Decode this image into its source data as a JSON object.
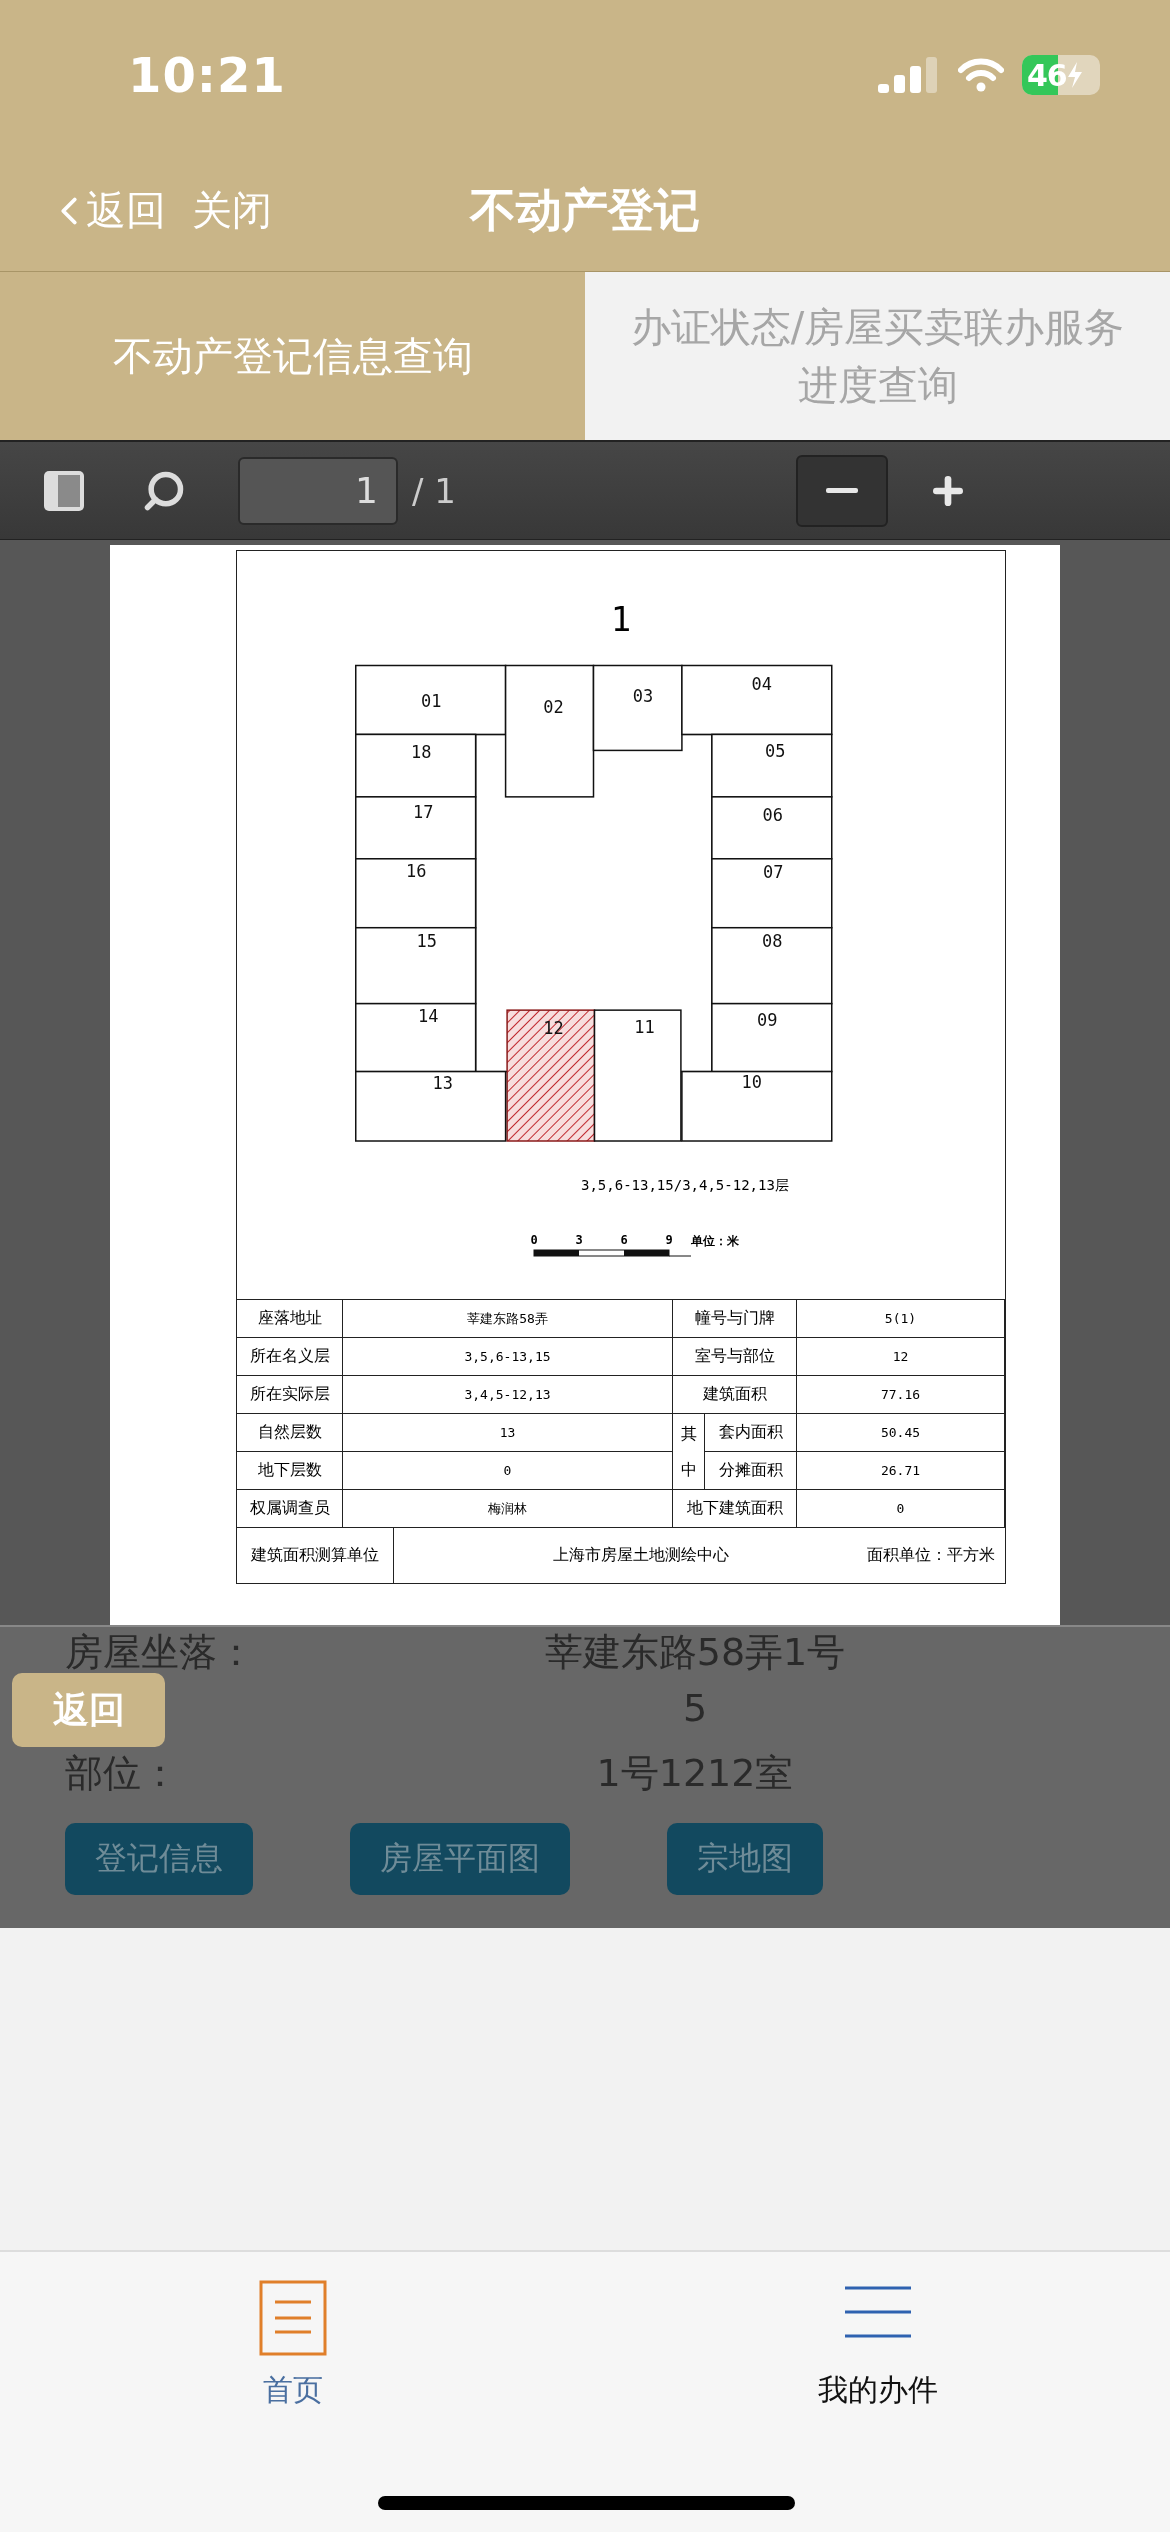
{
  "status_bar": {
    "time": "10:21",
    "battery": "46"
  },
  "nav": {
    "back": "返回",
    "close": "关闭",
    "title": "不动产登记"
  },
  "tabs": [
    {
      "label": "不动产登记信息查询",
      "selected": true
    },
    {
      "label": "办证状态/房屋买卖联办服务进度查询",
      "selected": false
    }
  ],
  "pdf_viewer": {
    "page_input": "1",
    "page_total": "/ 1",
    "document": {
      "title": "1",
      "rooms": [
        {
          "label": "01",
          "highlighted": false
        },
        {
          "label": "02",
          "highlighted": false
        },
        {
          "label": "03",
          "highlighted": false
        },
        {
          "label": "04",
          "highlighted": false
        },
        {
          "label": "18",
          "highlighted": false
        },
        {
          "label": "05",
          "highlighted": false
        },
        {
          "label": "17",
          "highlighted": false
        },
        {
          "label": "06",
          "highlighted": false
        },
        {
          "label": "16",
          "highlighted": false
        },
        {
          "label": "07",
          "highlighted": false
        },
        {
          "label": "15",
          "highlighted": false
        },
        {
          "label": "08",
          "highlighted": false
        },
        {
          "label": "14",
          "highlighted": false
        },
        {
          "label": "12",
          "highlighted": true
        },
        {
          "label": "11",
          "highlighted": false
        },
        {
          "label": "09",
          "highlighted": false
        },
        {
          "label": "13",
          "highlighted": false
        },
        {
          "label": "10",
          "highlighted": false
        }
      ],
      "floors_note": "3,5,6-13,15/3,4,5-12,13层",
      "scale": {
        "ticks": [
          "0",
          "3",
          "6",
          "9"
        ],
        "unit": "单位：米"
      },
      "table": {
        "group_label": "其中",
        "rows": [
          {
            "label": "座落地址",
            "value": "莘建东路58弄",
            "label_2": "幢号与门牌",
            "value_2": "5(1)",
            "in_group": false
          },
          {
            "label": "所在名义层",
            "value": "3,5,6-13,15",
            "label_2": "室号与部位",
            "value_2": "12",
            "in_group": false
          },
          {
            "label": "所在实际层",
            "value": "3,4,5-12,13",
            "label_2": "建筑面积",
            "value_2": "77.16",
            "in_group": false
          },
          {
            "label": "自然层数",
            "value": "13",
            "label_2": "套内面积",
            "value_2": "50.45",
            "in_group": true
          },
          {
            "label": "地下层数",
            "value": "0",
            "label_2": "分摊面积",
            "value_2": "26.71",
            "in_group": true
          },
          {
            "label": "权属调查员",
            "value": "梅润林",
            "label_2": "地下建筑面积",
            "value_2": "0",
            "in_group": false
          }
        ],
        "footer": {
          "label": "建筑面积测算单位",
          "value": "上海市房屋土地测绘中心",
          "unit": "面积单位：平方米"
        }
      }
    }
  },
  "details": {
    "rows": [
      {
        "label": "房屋坐落：",
        "value": "莘建东路58弄1号"
      },
      {
        "value": "5"
      },
      {
        "label": "部位：",
        "value": "1号1212室"
      }
    ],
    "buttons": [
      "登记信息",
      "房屋平面图",
      "宗地图"
    ],
    "back_button": "返回"
  },
  "bottom_tabs": [
    {
      "label": "首页",
      "selected": true
    },
    {
      "label": "我的办件",
      "selected": false
    }
  ]
}
